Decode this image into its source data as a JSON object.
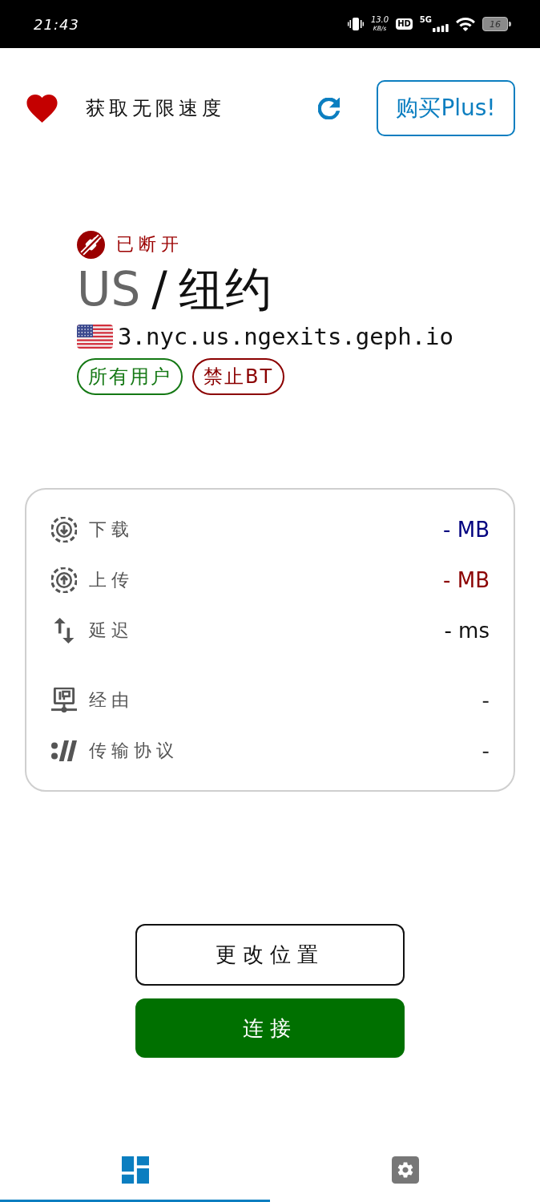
{
  "status_bar": {
    "time": "21:43",
    "speed_value": "13.0",
    "speed_unit": "KB/s",
    "hd": "HD",
    "network": "5G",
    "battery": "16"
  },
  "header": {
    "promo": "获取无限速度",
    "buy_button": "购买Plus!"
  },
  "connection": {
    "connected": false,
    "status": "已断开",
    "country": "US",
    "separator": "/",
    "city": "纽约",
    "hostname": "3.nyc.us.ngexits.geph.io",
    "tags": [
      {
        "label": "所有用户",
        "color": "#147814"
      },
      {
        "label": "禁止BT",
        "color": "#8b0000"
      }
    ]
  },
  "stats": {
    "traffic": [
      {
        "kind": "download",
        "label": "下载",
        "value": "- MB",
        "color": "#00007f"
      },
      {
        "kind": "upload",
        "label": "上传",
        "value": "- MB",
        "color": "#8b0000"
      },
      {
        "kind": "latency",
        "label": "延迟",
        "value": "- ms",
        "color": "#111111"
      }
    ],
    "route": [
      {
        "kind": "route",
        "label": "经由",
        "value": "-",
        "color": "#333333"
      },
      {
        "kind": "protocol",
        "label": "传输协议",
        "value": "-",
        "color": "#333333"
      }
    ]
  },
  "actions": [
    {
      "kind": "outline",
      "label": "更改位置"
    },
    {
      "kind": "primary",
      "label": "连接"
    }
  ],
  "nav": [
    {
      "kind": "dashboard",
      "selected": true
    },
    {
      "kind": "settings",
      "selected": false
    }
  ]
}
